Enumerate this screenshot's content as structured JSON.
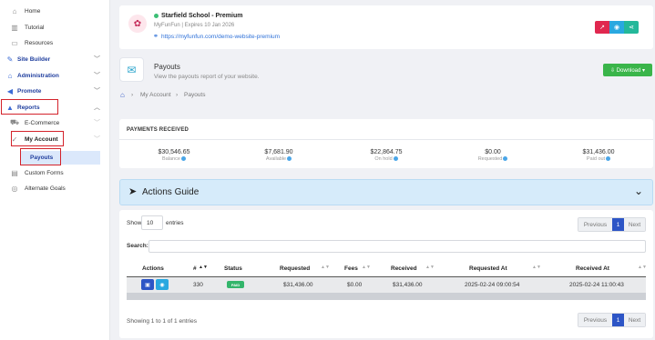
{
  "sidebar": {
    "items": [
      {
        "label": "Home",
        "icon": "home-icon"
      },
      {
        "label": "Tutorial",
        "icon": "book-icon"
      },
      {
        "label": "Resources",
        "icon": "folder-icon"
      },
      {
        "label": "Site Builder",
        "icon": "brush-icon"
      },
      {
        "label": "Administration",
        "icon": "bank-icon"
      },
      {
        "label": "Promote",
        "icon": "megaphone-icon"
      },
      {
        "label": "Reports",
        "icon": "chart-icon"
      },
      {
        "label": "E-Commerce",
        "icon": "cart-icon"
      },
      {
        "label": "My Account",
        "icon": "check-icon"
      },
      {
        "label": "Payouts",
        "icon": ""
      },
      {
        "label": "Custom Forms",
        "icon": "form-icon"
      },
      {
        "label": "Alternate Goals",
        "icon": "target-icon"
      }
    ]
  },
  "site": {
    "title": "Starfield School - Premium",
    "subtitle": "MyFunFun | Expires 10 Jan 2026",
    "url": "https://myfunfun.com/demo-website-premium"
  },
  "page": {
    "title": "Payouts",
    "subtitle": "View the payouts report of your website.",
    "download_label": "⇩ Download ▾",
    "breadcrumb": [
      "My Account",
      "Payouts"
    ]
  },
  "payments": {
    "title": "PAYMENTS RECEIVED",
    "stats": [
      {
        "value": "$30,546.65",
        "label": "Balance"
      },
      {
        "value": "$7,681.90",
        "label": "Available"
      },
      {
        "value": "$22,864.75",
        "label": "On hold"
      },
      {
        "value": "$0.00",
        "label": "Requested"
      },
      {
        "value": "$31,436.00",
        "label": "Paid out"
      }
    ]
  },
  "guide": {
    "title": "Actions Guide"
  },
  "table": {
    "show_label": "Show",
    "show_value": "10",
    "entries_label": "entries",
    "search_label": "Search:",
    "pager": {
      "prev": "Previous",
      "page": "1",
      "next": "Next"
    },
    "columns": [
      "Actions",
      "#",
      "Status",
      "Requested",
      "Fees",
      "Received",
      "Requested At",
      "Received At"
    ],
    "rows": [
      {
        "id": "330",
        "status": "PAID",
        "requested": "$31,436.00",
        "fees": "$0.00",
        "received": "$31,436.00",
        "requested_at": "2025-02-24 09:00:54",
        "received_at": "2025-02-24 11:00:43"
      }
    ],
    "footer": "Showing 1 to 1 of 1 entries"
  },
  "colors": {
    "primary": "#2d55c6",
    "success": "#3ab54a",
    "danger": "#d3222a",
    "info": "#2aa4cc"
  }
}
